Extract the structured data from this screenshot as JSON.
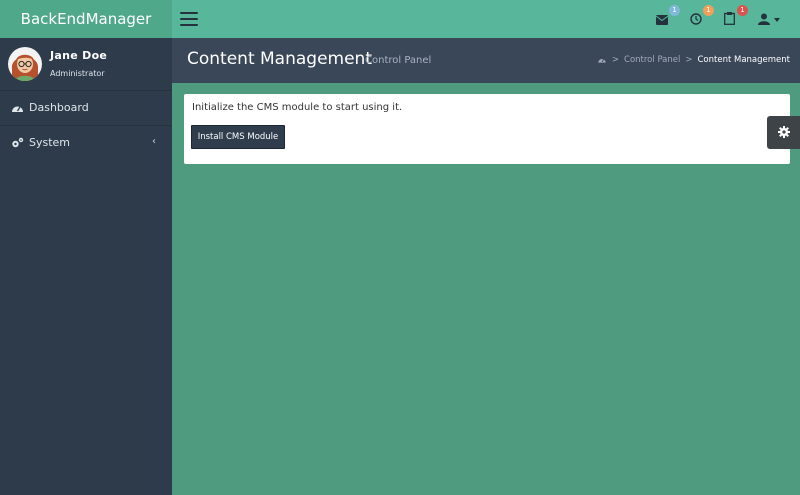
{
  "brand": "BackEndManager",
  "topbar": {
    "messages_badge": "1",
    "alerts_badge": "1",
    "tasks_badge": "1",
    "colors": {
      "messages_badge": "#7fb7dd",
      "alerts_badge": "#f0a05a",
      "tasks_badge": "#d9534f"
    }
  },
  "user": {
    "name": "Jane Doe",
    "role": "Administrator"
  },
  "sidebar": {
    "items": [
      {
        "label": "Dashboard",
        "icon": "dashboard-icon"
      },
      {
        "label": "System",
        "icon": "cogs-icon"
      }
    ]
  },
  "header": {
    "title": "Content Management",
    "subtitle": "Control Panel",
    "breadcrumb": {
      "link": "Control Panel",
      "separator": ">",
      "active": "Content Management"
    }
  },
  "main": {
    "message": "Initialize the CMS module to start using it.",
    "install_label": "Install CMS Module"
  }
}
